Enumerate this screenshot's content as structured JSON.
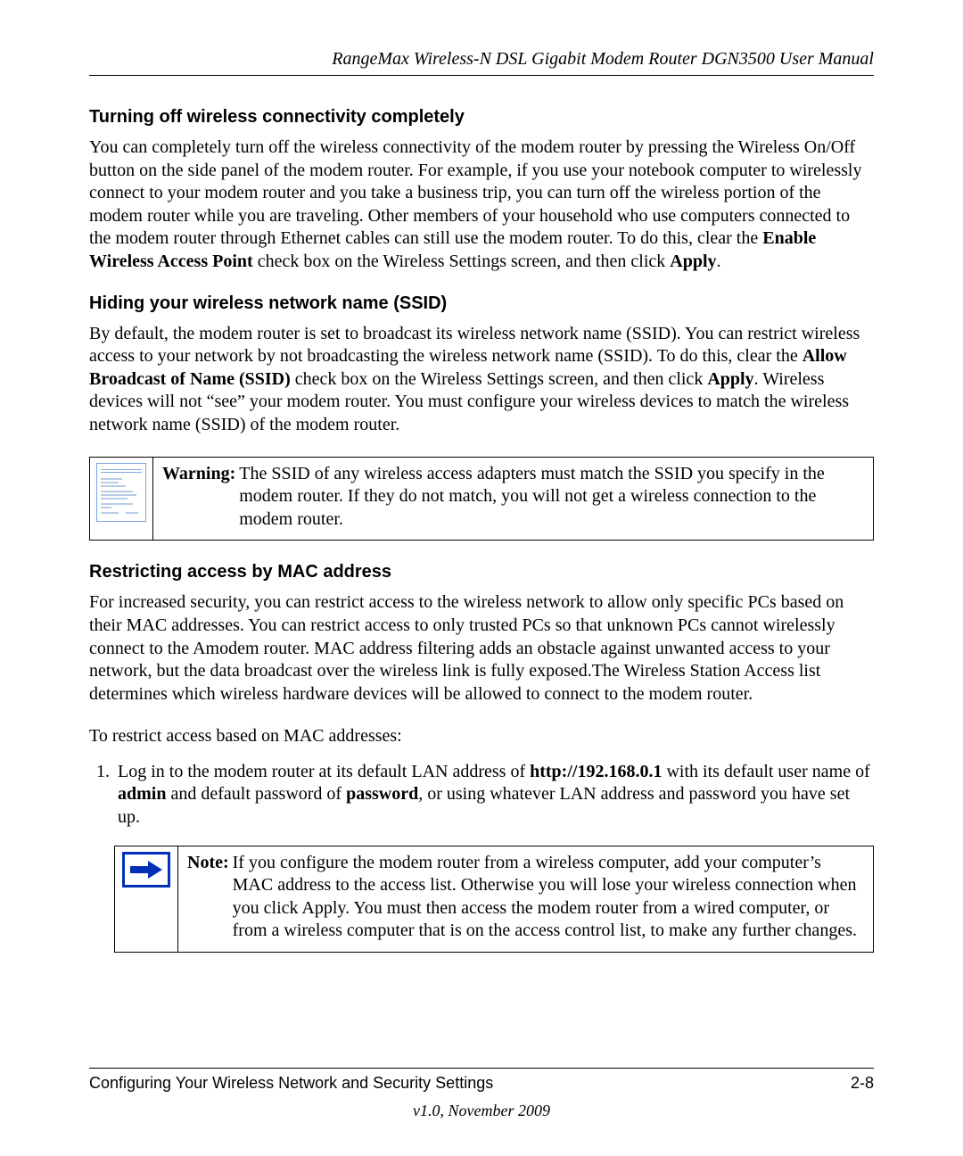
{
  "header": {
    "title": "RangeMax Wireless-N DSL Gigabit Modem Router DGN3500 User Manual"
  },
  "sections": {
    "s1": {
      "heading": "Turning off wireless connectivity completely",
      "body_pre": "You can completely turn off the wireless connectivity of the modem router by pressing the Wireless On/Off button on the side panel of the modem router. For example, if you use your notebook computer to wirelessly connect to your modem router and you take a business trip, you can turn off the wireless portion of the modem router while you are traveling. Other members of your household who use computers connected to the modem router through Ethernet cables can still use the modem router. To do this, clear the ",
      "bold1": "Enable Wireless Access Point",
      "body_mid": " check box on the Wireless Settings screen, and then click ",
      "bold2": "Apply",
      "body_post": "."
    },
    "s2": {
      "heading": "Hiding your wireless network name (SSID)",
      "body_pre": "By default, the modem router is set to broadcast its wireless network name (SSID). You can restrict wireless access to your network by not broadcasting the wireless network name (SSID). To do this, clear the ",
      "bold1": "Allow Broadcast of Name (SSID)",
      "body_mid": " check box on the Wireless Settings screen, and then click ",
      "bold2": "Apply",
      "body_post": ". Wireless devices will not “see” your modem router. You must configure your wireless devices to match the wireless network name (SSID) of the modem router."
    },
    "warning": {
      "label": "Warning:",
      "text": " The SSID of any wireless access adapters must match the SSID you specify in the modem router. If they do not match, you will not get a wireless connection to the modem router."
    },
    "s3": {
      "heading": "Restricting access by MAC address",
      "body": "For increased security, you can restrict access to the wireless network to allow only specific PCs based on their MAC addresses. You can restrict access to only trusted PCs so that unknown PCs cannot wirelessly connect to the Amodem router. MAC address filtering adds an obstacle against unwanted access to your network, but the data broadcast over the wireless link is fully exposed.The Wireless Station Access list determines which wireless hardware devices will be allowed to connect to the modem router.",
      "lead": "To restrict access based on MAC addresses:",
      "step1_pre": "Log in to the modem router at its default LAN address of ",
      "step1_b1": "http://192.168.0.1",
      "step1_mid1": " with its default user name of ",
      "step1_b2": "admin",
      "step1_mid2": " and default password of ",
      "step1_b3": "password",
      "step1_post": ", or using whatever LAN address and password you have set up."
    },
    "note": {
      "label": "Note:",
      "text": " If you configure the modem router from a wireless computer, add your computer’s MAC address to the access list. Otherwise you will lose your wireless connection when you click Apply. You must then access the modem router from a wired computer, or from a wireless computer that is on the access control list, to make any further changes."
    }
  },
  "footer": {
    "left": "Configuring Your Wireless Network and Security Settings",
    "right": "2-8",
    "version": "v1.0, November 2009"
  }
}
